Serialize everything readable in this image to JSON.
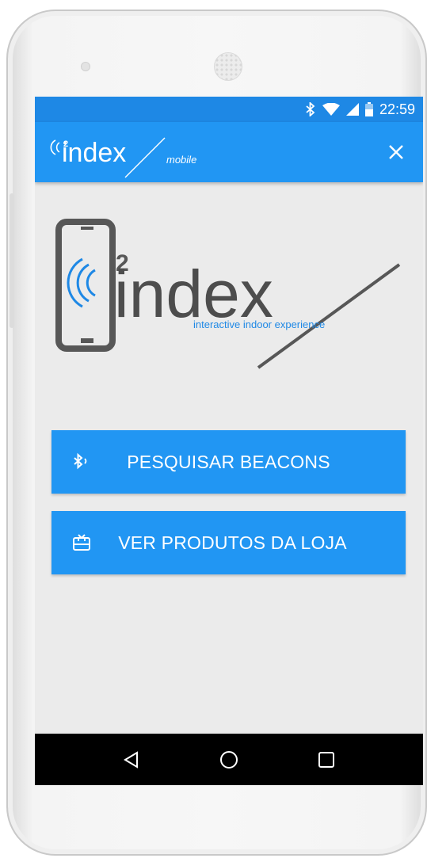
{
  "status_bar": {
    "time": "22:59",
    "icons": [
      "bluetooth-icon",
      "wifi-icon",
      "signal-icon",
      "battery-icon"
    ]
  },
  "app_bar": {
    "logo_text": "index",
    "logo_sub": "mobile",
    "close_icon": "close-icon",
    "color": "#2196f3"
  },
  "logo": {
    "text": "index",
    "tagline": "interactive indoor experience"
  },
  "buttons": [
    {
      "label": "PESQUISAR BEACONS",
      "icon": "bluetooth-searching-icon"
    },
    {
      "label": "VER PRODUTOS DA LOJA",
      "icon": "gift-card-icon"
    }
  ],
  "nav_bar": {
    "icons": [
      "back-icon",
      "home-icon",
      "recents-icon"
    ]
  },
  "colors": {
    "primary": "#2196f3",
    "status": "#1e88e5",
    "background": "#ebebeb"
  }
}
